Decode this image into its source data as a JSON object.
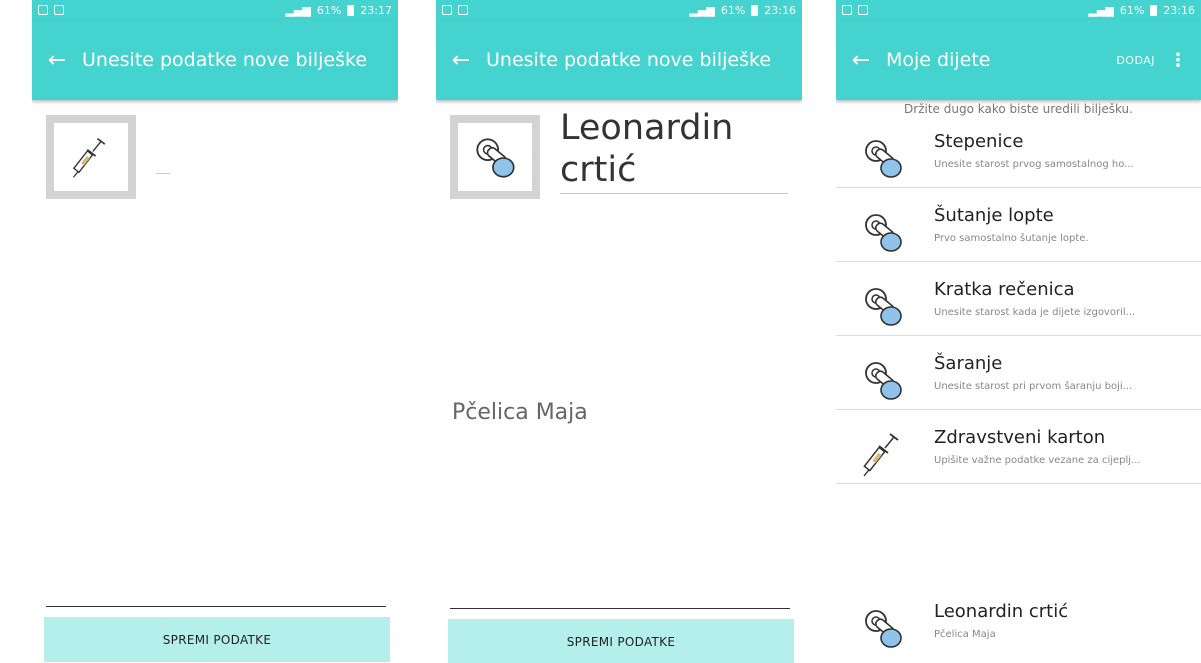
{
  "screen1": {
    "status_time": "23:17",
    "status_battery": "61%",
    "title": "Unesite podatke nove bilješke",
    "save_label": "SPREMI PODATKE",
    "image_icon": "syringe-icon"
  },
  "screen2": {
    "status_time": "23:16",
    "status_battery": "61%",
    "title": "Unesite podatke nove bilješke",
    "name_line1": "Leonardin",
    "name_line2": "crtić",
    "description": "Pčelica Maja",
    "save_label": "SPREMI PODATKE",
    "image_icon": "pacifier-icon"
  },
  "screen3": {
    "status_time": "23:16",
    "status_battery": "61%",
    "title": "Moje dijete",
    "action_label": "DODAJ",
    "hint": "Držite dugo kako biste uredili bilješku.",
    "items": [
      {
        "title": "Stepenice",
        "subtitle": "Unesite starost prvog samostalnog ho...",
        "icon": "pacifier-icon"
      },
      {
        "title": "Šutanje lopte",
        "subtitle": "Prvo samostalno šutanje lopte.",
        "icon": "pacifier-icon"
      },
      {
        "title": "Kratka rečenica",
        "subtitle": "Unesite starost kada je dijete izgovoril...",
        "icon": "pacifier-icon"
      },
      {
        "title": "Šaranje",
        "subtitle": "Unesite starost pri prvom šaranju boji...",
        "icon": "pacifier-icon"
      },
      {
        "title": "Zdravstveni karton",
        "subtitle": "Upišite važne podatke vezane za cijeplj...",
        "icon": "syringe-icon"
      },
      {
        "title": "Leonardin crtić",
        "subtitle": "Pčelica Maja",
        "icon": "pacifier-icon"
      }
    ]
  },
  "colors": {
    "accent": "#45d3cf",
    "button": "#b4efec",
    "pacifier_blue": "#8fc3ea"
  }
}
